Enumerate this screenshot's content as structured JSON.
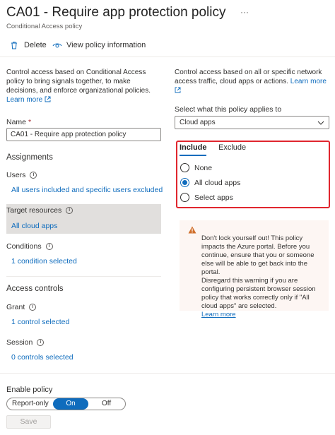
{
  "header": {
    "title": "CA01 - Require app protection policy",
    "more_label": "···",
    "subtitle": "Conditional Access policy"
  },
  "toolbar": {
    "delete_label": "Delete",
    "view_info_label": "View policy information"
  },
  "left": {
    "description": "Control access based on Conditional Access policy to bring signals together, to make decisions, and enforce organizational policies.",
    "learn_more": "Learn more",
    "name_label": "Name",
    "name_required": "*",
    "name_value": "CA01 - Require app protection policy",
    "assignments_heading": "Assignments",
    "users_label": "Users",
    "users_value": "All users included and specific users excluded",
    "target_label": "Target resources",
    "target_value": "All cloud apps",
    "conditions_label": "Conditions",
    "conditions_value": "1 condition selected",
    "access_heading": "Access controls",
    "grant_label": "Grant",
    "grant_value": "1 control selected",
    "session_label": "Session",
    "session_value": "0 controls selected"
  },
  "right": {
    "description": "Control access based on all or specific network access traffic, cloud apps or actions.",
    "learn_more": "Learn more",
    "applies_label": "Select what this policy applies to",
    "applies_value": "Cloud apps",
    "tabs": {
      "include": "Include",
      "exclude": "Exclude"
    },
    "options": [
      "None",
      "All cloud apps",
      "Select apps"
    ],
    "selected_option": "All cloud apps",
    "warning_text": "Don't lock yourself out! This policy impacts the Azure portal. Before you continue, ensure that you or someone else will be able to get back into the portal.\nDisregard this warning if you are configuring persistent browser session policy that works correctly only if \"All cloud apps\" are selected.",
    "warning_link": "Learn more"
  },
  "footer": {
    "enable_label": "Enable policy",
    "toggle_options": [
      "Report-only",
      "On",
      "Off"
    ],
    "toggle_selected": "On",
    "save_label": "Save"
  },
  "colors": {
    "accent": "#0f6cbd",
    "highlight_border": "#e0262e",
    "warning_bg": "#fdf6f3",
    "warning_icon": "#d06f2b",
    "selected_row_bg": "#e1dfdd"
  }
}
